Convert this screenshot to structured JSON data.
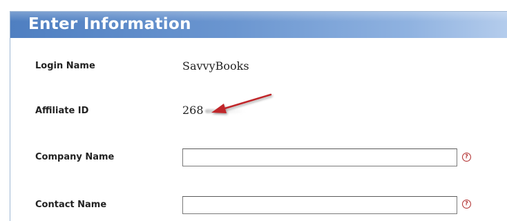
{
  "panel": {
    "title": "Enter Information"
  },
  "fields": {
    "login_name": {
      "label": "Login Name",
      "value": "SavvyBooks"
    },
    "affiliate_id": {
      "label": "Affiliate ID",
      "value_visible": "268"
    },
    "company_name": {
      "label": "Company Name",
      "value": "",
      "help_symbol": "?"
    },
    "contact_name": {
      "label": "Contact Name",
      "value": "",
      "help_symbol": "?"
    }
  },
  "colors": {
    "header_start": "#4f7fc1",
    "header_end": "#b4ccec",
    "arrow": "#c0282a",
    "help_icon": "#b03030"
  },
  "icons": [
    "help-icon",
    "arrow-annotation"
  ]
}
